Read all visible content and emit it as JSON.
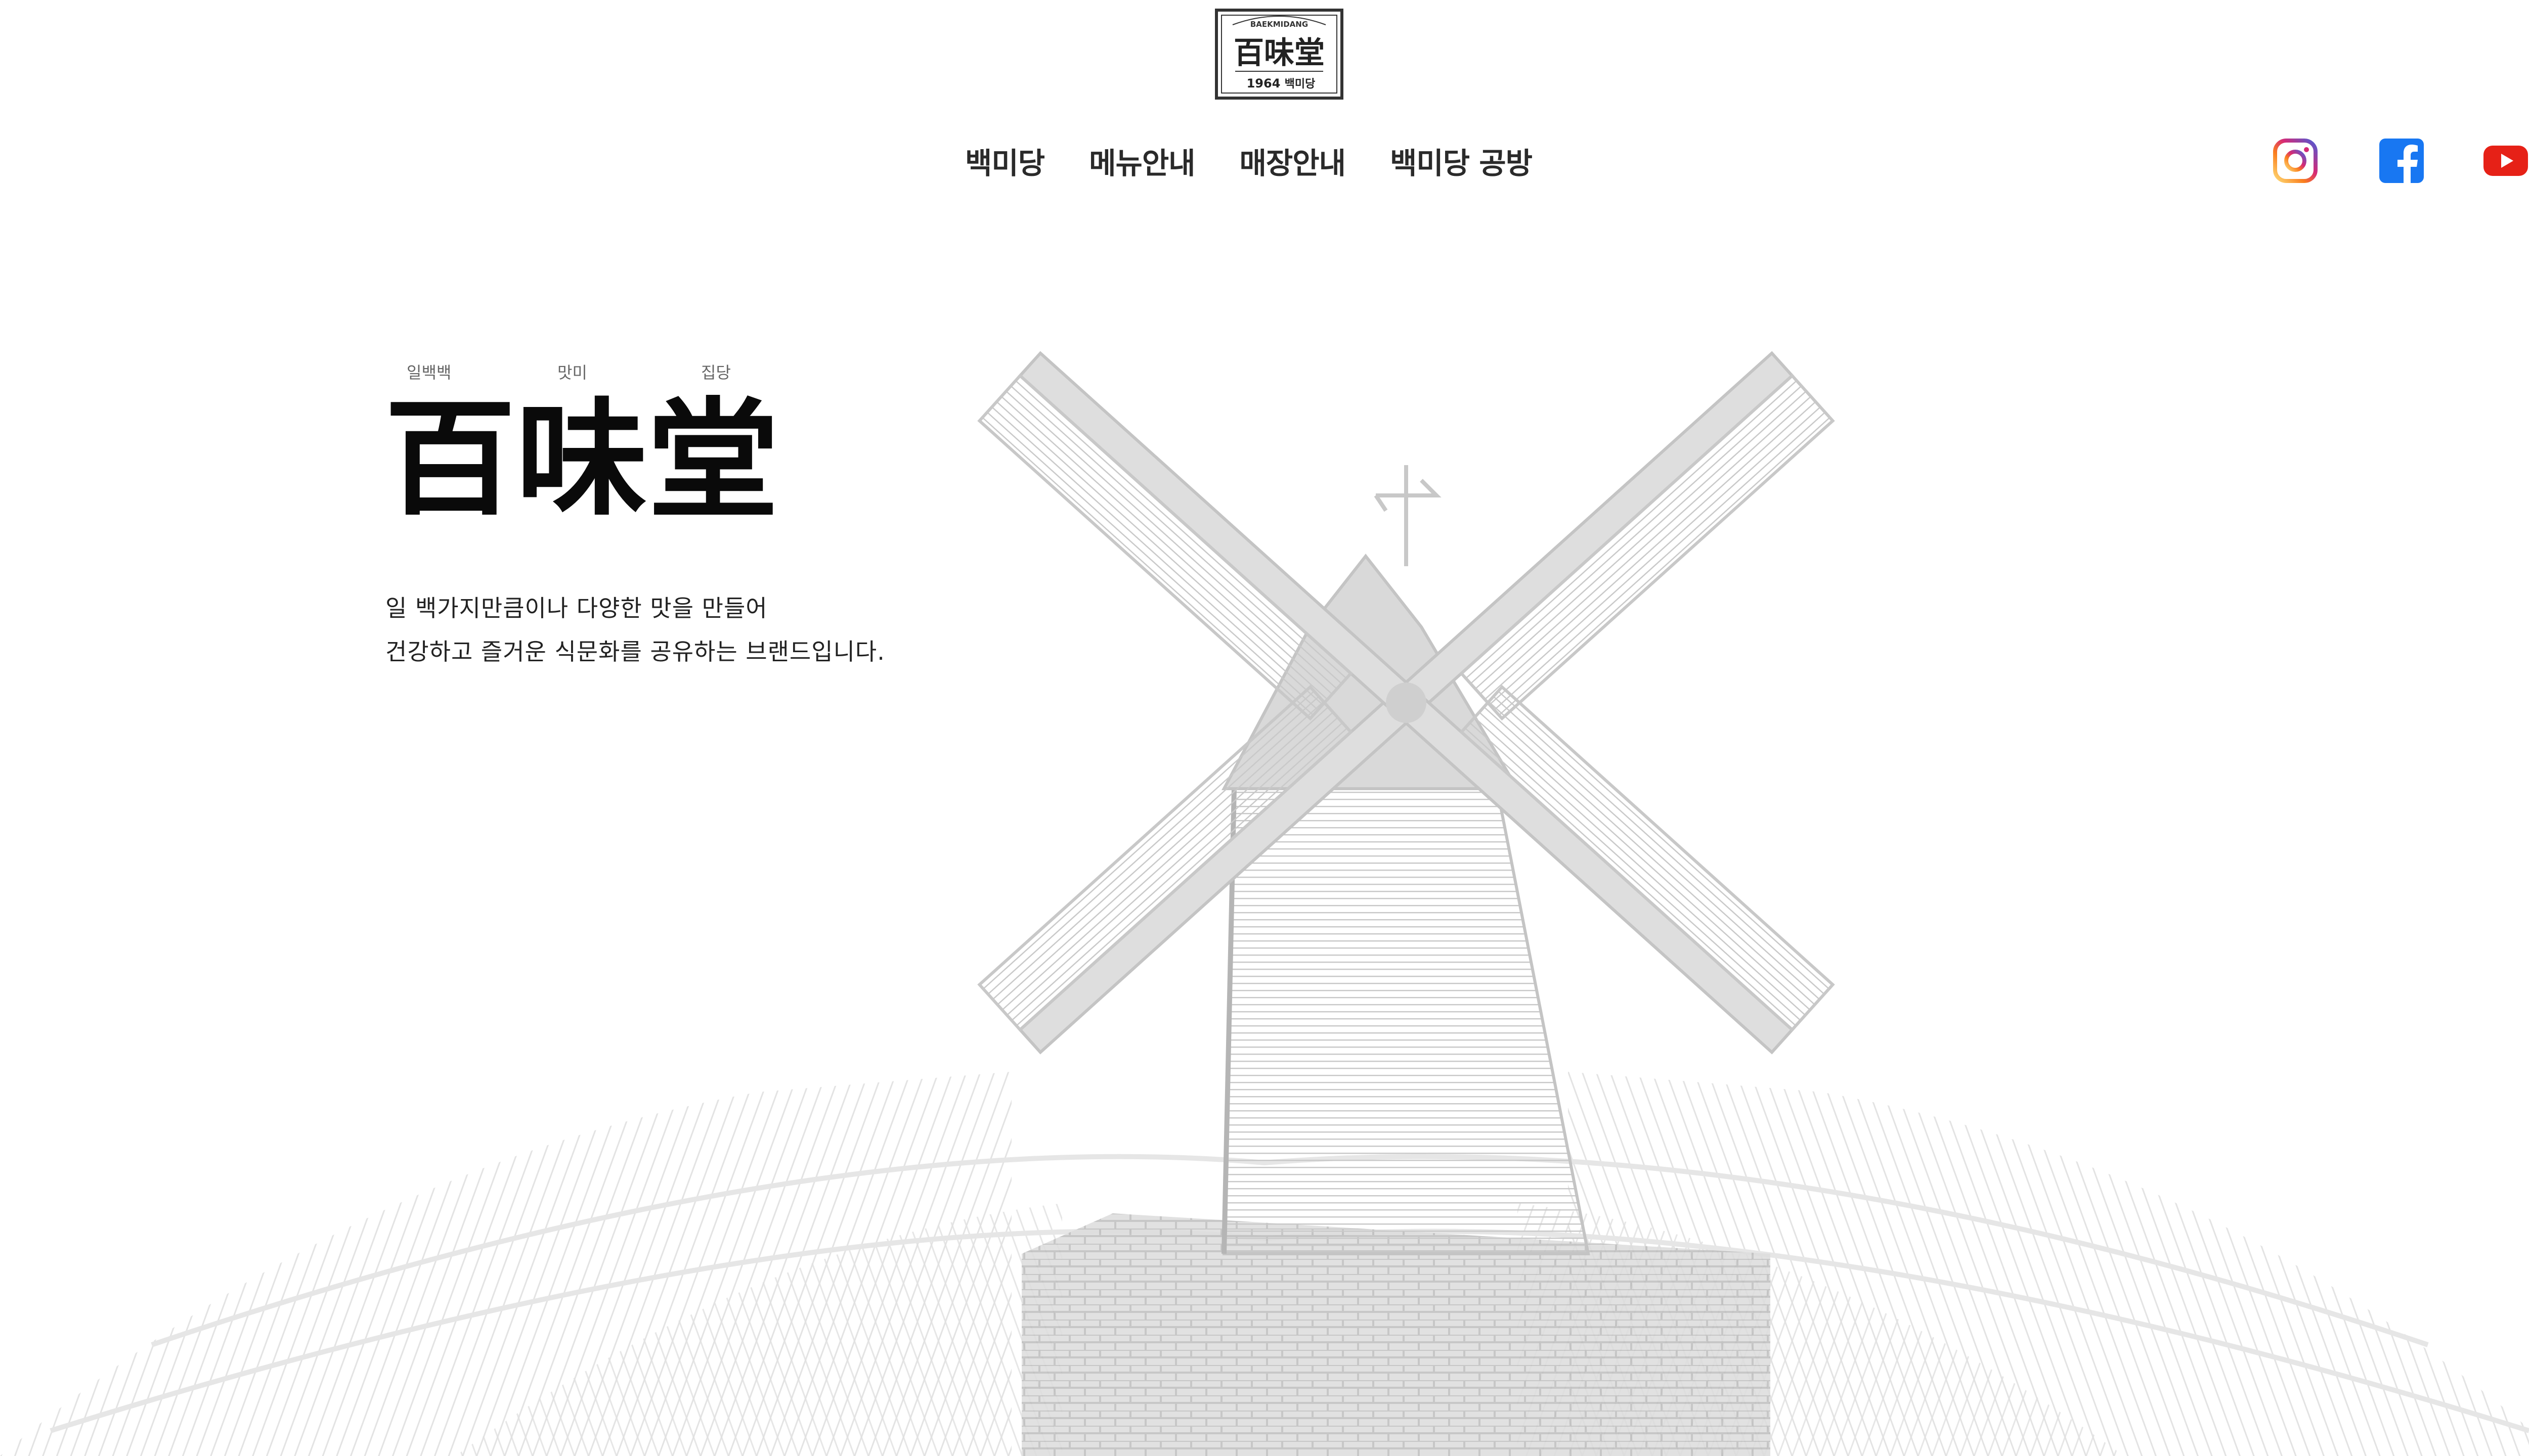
{
  "brand": {
    "seal_top_text": "BAEKMIDANG",
    "seal_chinese": "百味堂",
    "seal_year": "1964",
    "seal_korean": "백미당"
  },
  "nav": {
    "items": [
      "백미당",
      "메뉴안내",
      "매장안내",
      "백미당 공방"
    ]
  },
  "social": {
    "instagram_icon": "instagram-icon",
    "facebook_icon": "facebook-icon",
    "youtube_icon": "youtube-icon",
    "instagram_color": "#c13584",
    "facebook_color": "#1877f2",
    "youtube_color": "#e62117"
  },
  "hero": {
    "ruby": [
      "일백백",
      "맛미",
      "집당"
    ],
    "title": "百味堂",
    "description": [
      "일 백가지만큼이나 다양한 맛을 만들어",
      "건강하고 즐거운 식문화를 공유하는 브랜드입니다."
    ]
  },
  "colors": {
    "illustration": "#d0d0d0",
    "text": "#222222"
  }
}
